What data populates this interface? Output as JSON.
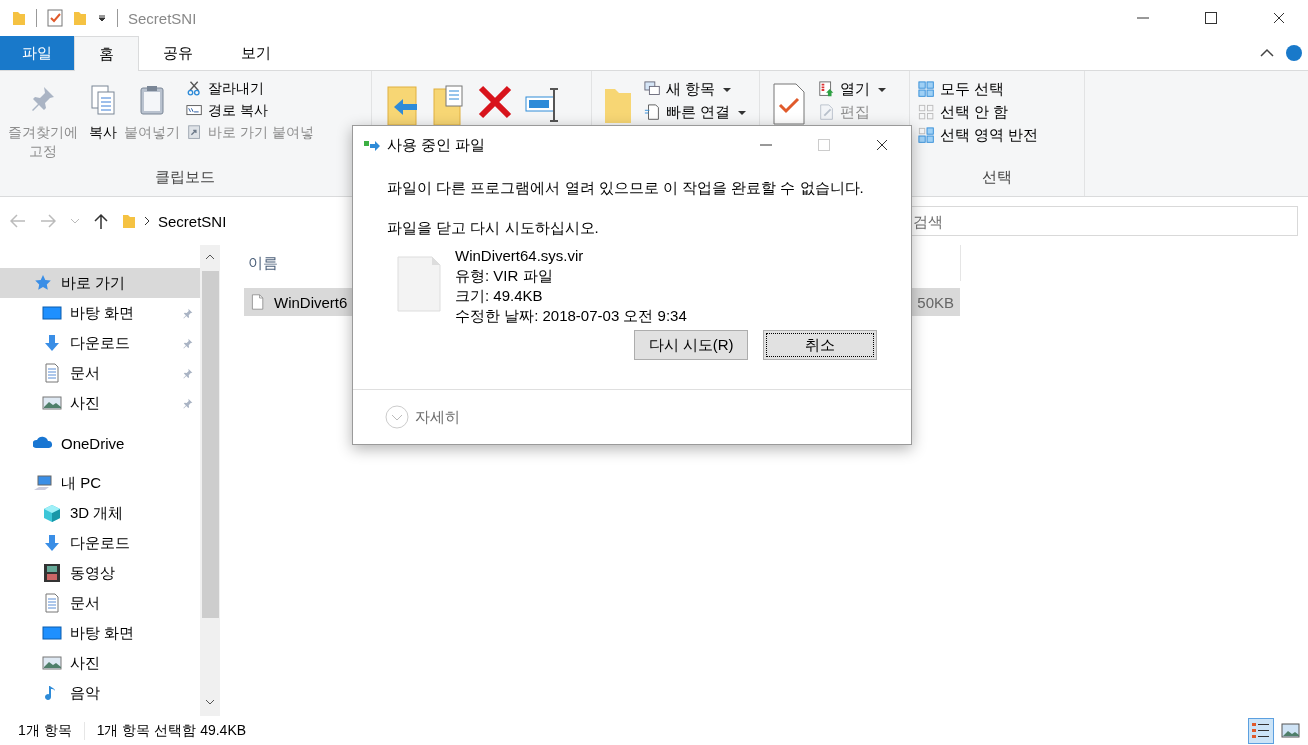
{
  "window": {
    "title": "SecretSNI"
  },
  "ribbon_tabs": [
    {
      "label": "파일",
      "kind": "file",
      "selected": false
    },
    {
      "label": "홈",
      "kind": "tab",
      "selected": true
    },
    {
      "label": "공유",
      "kind": "tab",
      "selected": false
    },
    {
      "label": "보기",
      "kind": "tab",
      "selected": false
    }
  ],
  "clipboard": {
    "label": "클립보드",
    "large": [
      {
        "label": "즐겨찾기에 고정",
        "kind": "pin",
        "disabled": true
      },
      {
        "label": "복사",
        "kind": "copy",
        "disabled": false
      },
      {
        "label": "붙여넣기",
        "kind": "paste",
        "disabled": true
      }
    ],
    "small": [
      {
        "label": "잘라내기",
        "kind": "scissors",
        "disabled": false
      },
      {
        "label": "경로 복사",
        "kind": "path",
        "disabled": false
      },
      {
        "label": "바로 가기 붙여넣",
        "kind": "shortcut",
        "disabled": true
      }
    ]
  },
  "new_group": {
    "small": [
      {
        "label": "새 항목",
        "kind": "new-item",
        "dropdown": true
      },
      {
        "label": "빠른 연결",
        "kind": "easy-access",
        "dropdown": true
      }
    ]
  },
  "open_group": {
    "small": [
      {
        "label": "열기",
        "kind": "open",
        "dropdown": true,
        "disabled": false
      },
      {
        "label": "편집",
        "kind": "edit",
        "dropdown": false,
        "disabled": true
      }
    ]
  },
  "select_group": {
    "label": "선택",
    "small": [
      {
        "label": "모두 선택",
        "kind": "select-all"
      },
      {
        "label": "선택 안 함",
        "kind": "select-none"
      },
      {
        "label": "선택 영역 반전",
        "kind": "invert"
      }
    ]
  },
  "address": {
    "path": "SecretSNI"
  },
  "search": {
    "placeholder": "검색"
  },
  "sidebar": {
    "items": [
      {
        "label": "바로 가기",
        "kind": "star",
        "selected": true,
        "children": [
          {
            "label": "바탕 화면",
            "kind": "desktop",
            "selected": false,
            "pinned": true
          },
          {
            "label": "다운로드",
            "kind": "download",
            "selected": false,
            "pinned": true
          },
          {
            "label": "문서",
            "kind": "document",
            "selected": false,
            "pinned": true
          },
          {
            "label": "사진",
            "kind": "picture",
            "selected": false,
            "pinned": true
          }
        ]
      },
      {
        "label": "OneDrive",
        "kind": "cloud",
        "selected": false
      },
      {
        "label": "내 PC",
        "kind": "pc",
        "selected": false,
        "children": [
          {
            "label": "3D 개체",
            "kind": "cube",
            "selected": false,
            "pinned": false
          },
          {
            "label": "다운로드",
            "kind": "download",
            "selected": false,
            "pinned": false
          },
          {
            "label": "동영상",
            "kind": "video",
            "selected": false,
            "pinned": false
          },
          {
            "label": "문서",
            "kind": "document",
            "selected": false,
            "pinned": false
          },
          {
            "label": "바탕 화면",
            "kind": "desktop",
            "selected": false,
            "pinned": false
          },
          {
            "label": "사진",
            "kind": "picture",
            "selected": false,
            "pinned": false
          },
          {
            "label": "음악",
            "kind": "music",
            "selected": false,
            "pinned": false
          }
        ]
      }
    ]
  },
  "file_list": {
    "columns": [
      "이름"
    ],
    "rows": [
      {
        "name": "WinDivert6",
        "size": "50KB",
        "selected": true
      }
    ]
  },
  "status_bar": {
    "count": "1개 항목",
    "selection": "1개 항목 선택함 49.4KB",
    "views": [
      {
        "kind": "details",
        "selected": true
      },
      {
        "kind": "thumbnails",
        "selected": false
      }
    ]
  },
  "dialog": {
    "title": "사용 중인 파일",
    "message": "파일이 다른 프로그램에서 열려 있으므로 이 작업을 완료할 수 없습니다.",
    "instruction": "파일을 닫고 다시 시도하십시오.",
    "file": {
      "name": "WinDivert64.sys.vir",
      "type": "유형: VIR 파일",
      "size": "크기: 49.4KB",
      "modified": "수정한 날짜: 2018-07-03 오전 9:34"
    },
    "buttons": [
      {
        "label": "다시 시도(R)",
        "focused": false
      },
      {
        "label": "취소",
        "focused": true
      }
    ],
    "details": "자세히"
  }
}
